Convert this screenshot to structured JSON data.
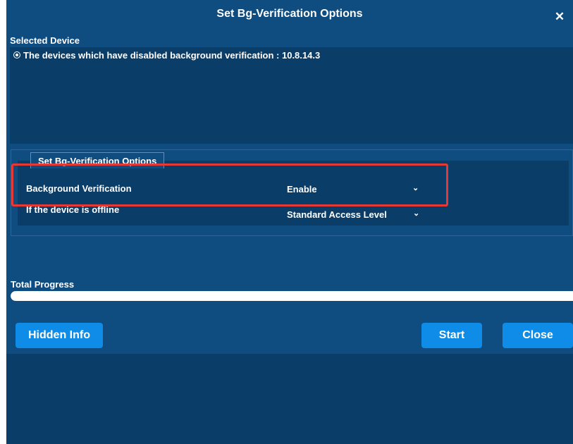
{
  "dialog": {
    "title": "Set Bg-Verification Options",
    "close_icon": "close-icon",
    "close_glyph": "✕"
  },
  "selected_device": {
    "label": "Selected Device",
    "item": "The devices which have disabled background verification : 10.8.14.3"
  },
  "options": {
    "legend": "Set Bg-Verification Options",
    "rows": [
      {
        "label": "Background Verification",
        "value": "Enable"
      },
      {
        "label": "If the device is offline",
        "value": "Standard Access Level"
      }
    ],
    "chevron": "⌄"
  },
  "progress": {
    "label": "Total Progress",
    "value": 1.0
  },
  "buttons": {
    "hidden_info": "Hidden Info",
    "start": "Start",
    "close": "Close"
  },
  "colors": {
    "background": "#0f4c80",
    "panel": "#0a3d67",
    "button": "#0e8ce8",
    "highlight": "#e53935"
  }
}
